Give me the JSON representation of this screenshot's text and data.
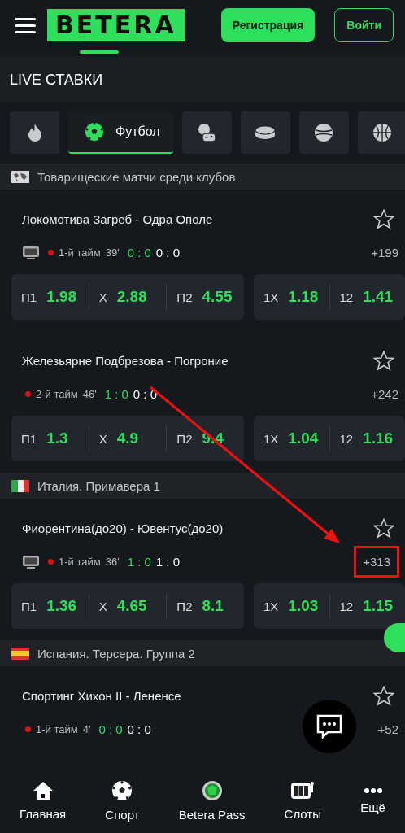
{
  "header": {
    "logo": "BETERA",
    "register_button": "Регистрация",
    "login_button": "Войти"
  },
  "page_title": "LIVE СТАВКИ",
  "sport_tabs": [
    {
      "kind": "fire",
      "selected": false
    },
    {
      "kind": "football",
      "label": "Футбол",
      "selected": true
    },
    {
      "kind": "esports",
      "selected": false
    },
    {
      "kind": "hockey",
      "selected": false
    },
    {
      "kind": "tennis",
      "selected": false
    },
    {
      "kind": "basketball",
      "selected": false
    }
  ],
  "leagues": [
    {
      "kind": "world",
      "name": "Товарищеские матчи среди клубов",
      "matches": [
        {
          "teams": "Локомотива Загреб - Одра Ополе",
          "tv": true,
          "period": "1-й тайм",
          "minute": "39'",
          "score_period": "0 : 0",
          "score": "0 : 0",
          "more": "+199",
          "highlighted": false,
          "odds": [
            [
              {
                "label": "П1",
                "value": "1.98"
              },
              {
                "label": "X",
                "value": "2.88"
              },
              {
                "label": "П2",
                "value": "4.55"
              }
            ],
            [
              {
                "label": "1X",
                "value": "1.18"
              },
              {
                "label": "12",
                "value": "1.41"
              }
            ]
          ]
        },
        {
          "teams": "Железьярне Подбрезова - Погроние",
          "tv": false,
          "period": "2-й тайм",
          "minute": "46'",
          "score_period": "1 : 0",
          "score": "0 : 0",
          "more": "+242",
          "highlighted": false,
          "odds": [
            [
              {
                "label": "П1",
                "value": "1.3"
              },
              {
                "label": "X",
                "value": "4.9"
              },
              {
                "label": "П2",
                "value": "9.4"
              }
            ],
            [
              {
                "label": "1X",
                "value": "1.04"
              },
              {
                "label": "12",
                "value": "1.16"
              }
            ]
          ]
        }
      ]
    },
    {
      "kind": "italy",
      "name": "Италия. Примавера 1",
      "matches": [
        {
          "teams": "Фиорентина(до20) - Ювентус(до20)",
          "tv": true,
          "period": "1-й тайм",
          "minute": "36'",
          "score_period": "1 : 0",
          "score": "1 : 0",
          "more": "+313",
          "highlighted": true,
          "odds": [
            [
              {
                "label": "П1",
                "value": "1.36"
              },
              {
                "label": "X",
                "value": "4.65"
              },
              {
                "label": "П2",
                "value": "8.1"
              }
            ],
            [
              {
                "label": "1X",
                "value": "1.03"
              },
              {
                "label": "12",
                "value": "1.15"
              }
            ]
          ]
        }
      ]
    },
    {
      "kind": "spain",
      "name": "Испания. Терсера. Группа 2",
      "matches": [
        {
          "teams": "Спортинг Хихон II - Лененсе",
          "tv": false,
          "period": "1-й тайм",
          "minute": "4'",
          "score_period": "0 : 0",
          "score": "0 : 0",
          "more": "+52",
          "highlighted": false
        }
      ]
    }
  ],
  "annotation": {
    "kind": "arrow"
  },
  "bottom_nav": [
    {
      "kind": "home",
      "label": "Главная"
    },
    {
      "kind": "sport",
      "label": "Спорт"
    },
    {
      "kind": "pass",
      "label": "Betera Pass"
    },
    {
      "kind": "slots",
      "label": "Слоты"
    },
    {
      "kind": "more",
      "label": "Ещё"
    }
  ]
}
